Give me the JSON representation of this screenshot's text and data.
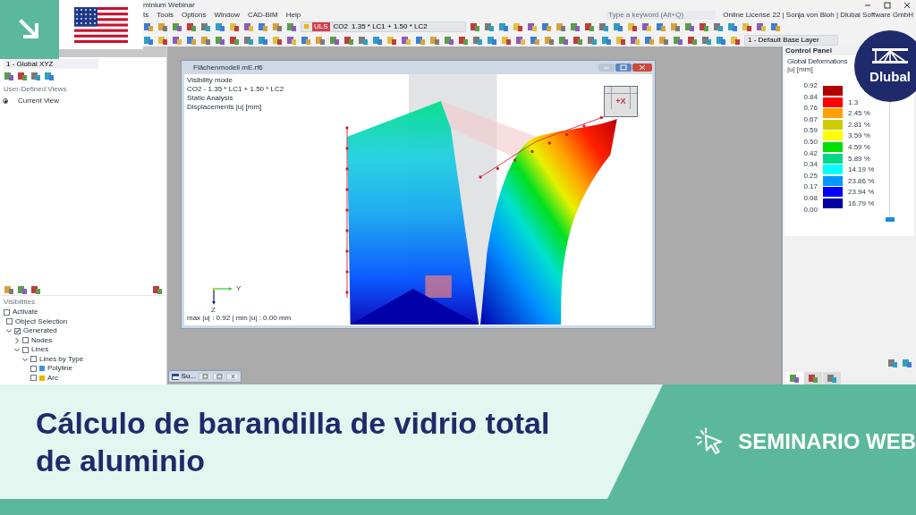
{
  "app": {
    "title": "minium Webinar",
    "menu": [
      "ts",
      "Tools",
      "Options",
      "Window",
      "CAD-BIM",
      "Help"
    ],
    "search": {
      "placeholder": "Type a keyword (Alt+Q)"
    },
    "license": "Online License 22 | Sonja von Bloh | Dlubal Software GmbH",
    "toolbar": {
      "badge": "ULS",
      "load_case": "CO2",
      "combination": "1.35 * LC1 + 1.50 * LC2",
      "layer": "1 - Default Base Layer"
    }
  },
  "navigator": {
    "view_select": "1 - Global XYZ",
    "section": "User-Defined Views",
    "views": [
      {
        "label": "Current View",
        "selected": true
      }
    ],
    "visibilities_title": "Visibilities",
    "tree": [
      {
        "label": "Activate",
        "checked": false
      },
      {
        "label": "Object Selection",
        "checked": false
      },
      {
        "label": "Generated",
        "checked": true,
        "expanded": true,
        "children": [
          {
            "label": "Nodes",
            "checked": false,
            "expanded": false
          },
          {
            "label": "Lines",
            "checked": false,
            "expanded": true,
            "children": [
              {
                "label": "Lines by Type",
                "checked": false,
                "expanded": true,
                "children": [
                  {
                    "label": "Polyline",
                    "checked": false,
                    "color": "#3d8ff0"
                  },
                  {
                    "label": "Arc",
                    "checked": false,
                    "color": "#f0b400"
                  }
                ]
              }
            ]
          }
        ]
      }
    ]
  },
  "model_window": {
    "title": "Flächenmodell mE.rf6",
    "info": [
      "Visibility mode",
      "CO2 - 1.35 * LC1 + 1.50 * LC2",
      "Static Analysis",
      "Displacements |u| [mm]"
    ],
    "cube_label": "+X",
    "axis_y": "Y",
    "axis_z": "Z",
    "summary": "max |u| : 0.92 | min |u| : 0.00 mm"
  },
  "minimized_window": {
    "title": "Su..."
  },
  "control_panel": {
    "title": "Control Panel",
    "heading": "Global Deformations",
    "unit": "|u| [mm]",
    "ticks": [
      "0.92",
      "0.84",
      "0.76",
      "0.67",
      "0.59",
      "0.50",
      "0.42",
      "0.34",
      "0.25",
      "0.17",
      "0.08",
      "0.00"
    ],
    "bands": [
      {
        "color": "#b00000"
      },
      {
        "color": "#ff0000",
        "percent": "1.3"
      },
      {
        "color": "#ffa000",
        "percent": "2.45 %"
      },
      {
        "color": "#cccc00",
        "percent": "2.81 %"
      },
      {
        "color": "#ffff00",
        "percent": "3.59 %"
      },
      {
        "color": "#00e000",
        "percent": "4.59 %"
      },
      {
        "color": "#00d888",
        "percent": "5.89 %"
      },
      {
        "color": "#00ffff",
        "percent": "14.19 %"
      },
      {
        "color": "#0098ff",
        "percent": "23.86 %"
      },
      {
        "color": "#0000ff",
        "percent": "23.94 %"
      },
      {
        "color": "#0000a0",
        "percent": "16.79 %"
      }
    ],
    "tabs": [
      {
        "selected": true
      },
      {
        "selected": false
      },
      {
        "selected": false
      }
    ]
  },
  "brand": "Dlubal",
  "banner": {
    "title": "Cálculo de barandilla de vidrio total de aluminio",
    "tag": "SEMINARIO WEB"
  }
}
